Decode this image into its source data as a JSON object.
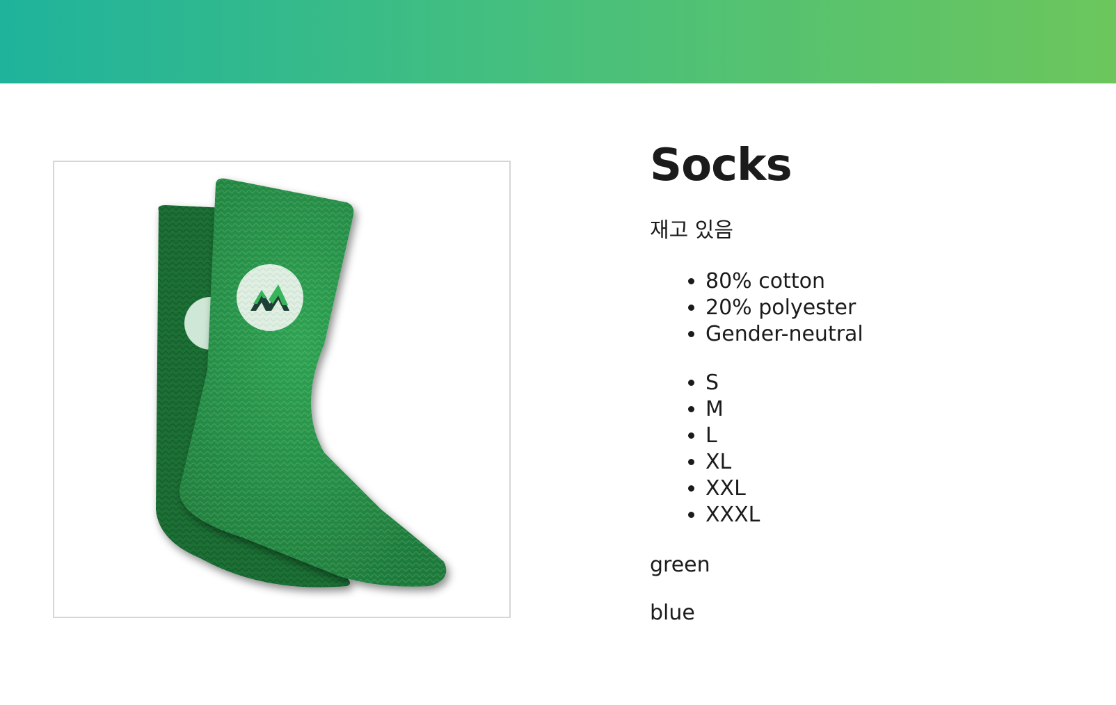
{
  "header": {
    "gradient_start": "#1fb39c",
    "gradient_end": "#6cc65c"
  },
  "product": {
    "image_icon": "green-socks-image",
    "title": "Socks",
    "stock_status": "재고 있음",
    "features": [
      "80% cotton",
      "20% polyester",
      "Gender-neutral"
    ],
    "sizes": [
      "S",
      "M",
      "L",
      "XL",
      "XXL",
      "XXXL"
    ],
    "colors": [
      "green",
      "blue"
    ]
  }
}
